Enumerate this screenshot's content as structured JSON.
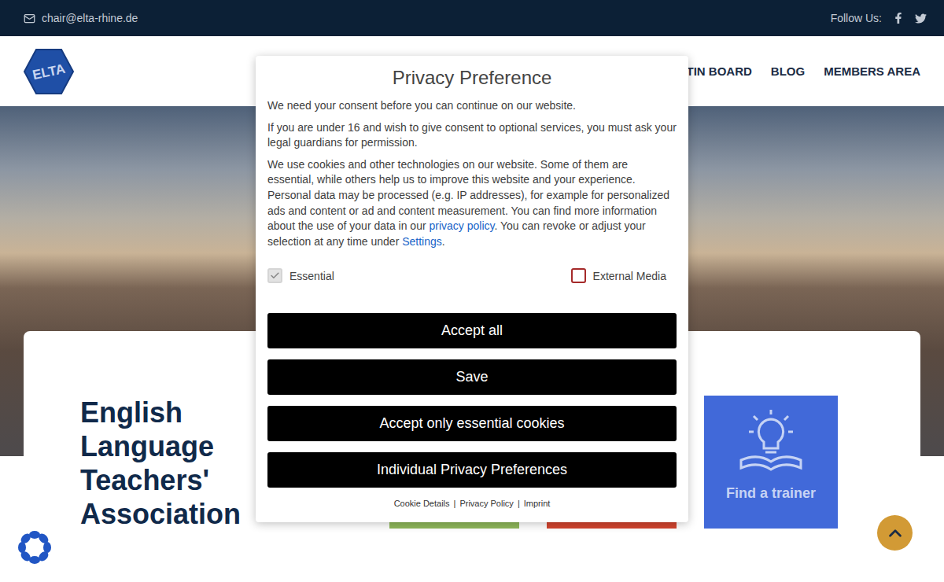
{
  "top_bar": {
    "email": "chair@elta-rhine.de",
    "follow_label": "Follow Us:"
  },
  "logo": {
    "text": "ELTA"
  },
  "nav": {
    "items": [
      "LETIN BOARD",
      "BLOG",
      "MEMBERS AREA"
    ]
  },
  "hero": {
    "heading": [
      "English",
      "Language",
      "Teachers'",
      "Association"
    ],
    "tiles": [
      {
        "label": "Find a trainer",
        "color": "#4169d9"
      }
    ]
  },
  "privacy_dialog": {
    "title": "Privacy Preference",
    "paragraphs": [
      [
        {
          "text": "We need your consent before you can continue on our website.",
          "link": false
        }
      ],
      [
        {
          "text": "If you are under 16 and wish to give consent to optional services, you must ask your legal guardians for permission.",
          "link": false
        }
      ],
      [
        {
          "text": "We use cookies and other technologies on our website. Some of them are essential, while others help us to improve this website and your experience. Personal data may be processed (e.g. IP addresses), for example for personalized ads and content or ad and content measurement. You can find more information about the use of your data in our ",
          "link": false
        },
        {
          "text": "privacy policy",
          "link": true
        },
        {
          "text": ". You can revoke or adjust your selection at any time under ",
          "link": false
        },
        {
          "text": "Settings",
          "link": true
        },
        {
          "text": ".",
          "link": false
        }
      ]
    ],
    "options": [
      {
        "label": "Essential",
        "checked": true,
        "disabled": true
      },
      {
        "label": "External Media",
        "checked": false,
        "disabled": false
      }
    ],
    "buttons": [
      "Accept all",
      "Save",
      "Accept only essential cookies",
      "Individual Privacy Preferences"
    ],
    "footer_links": [
      "Cookie Details",
      "Privacy Policy",
      "Imprint"
    ],
    "separator": "|"
  }
}
